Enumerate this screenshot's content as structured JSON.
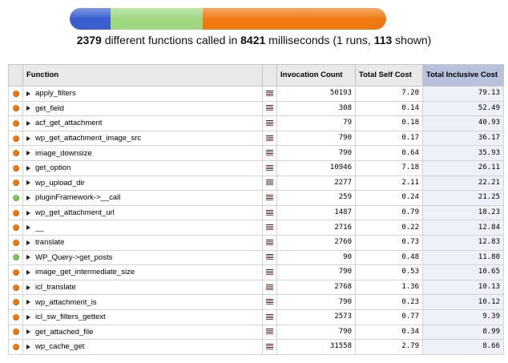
{
  "overview_bar": {
    "segments": [
      {
        "name": "blue",
        "share": 0.13,
        "color": "#3b5fd0"
      },
      {
        "name": "green",
        "share": 0.29,
        "color": "#9fd680"
      },
      {
        "name": "orange",
        "share": 0.58,
        "color": "#f07a12"
      }
    ]
  },
  "summary": {
    "function_count": "2379",
    "text1": " different functions called in ",
    "milliseconds": "8421",
    "text2": " milliseconds (1 runs, ",
    "shown": "113",
    "text3": " shown)"
  },
  "table": {
    "headers": {
      "function": "Function",
      "invocation_count": "Invocation Count",
      "total_self_cost": "Total Self Cost",
      "total_inclusive_cost": "Total Inclusive Cost"
    },
    "colors": {
      "orange": "#f07a12",
      "green": "#7ec956"
    },
    "rows": [
      {
        "name": "apply_filters",
        "dot": "orange",
        "count": "50193",
        "self": "7.20",
        "incl": "79.13"
      },
      {
        "name": "get_field",
        "dot": "orange",
        "count": "308",
        "self": "0.14",
        "incl": "52.49"
      },
      {
        "name": "acf_get_attachment",
        "dot": "orange",
        "count": "79",
        "self": "0.18",
        "incl": "40.93"
      },
      {
        "name": "wp_get_attachment_image_src",
        "dot": "orange",
        "count": "790",
        "self": "0.17",
        "incl": "36.17"
      },
      {
        "name": "image_downsize",
        "dot": "orange",
        "count": "790",
        "self": "0.64",
        "incl": "35.93"
      },
      {
        "name": "get_option",
        "dot": "orange",
        "count": "10946",
        "self": "7.18",
        "incl": "26.11"
      },
      {
        "name": "wp_upload_dir",
        "dot": "orange",
        "count": "2277",
        "self": "2.11",
        "incl": "22.21"
      },
      {
        "name": "pluginFramework->__call",
        "dot": "green",
        "count": "259",
        "self": "0.24",
        "incl": "21.25"
      },
      {
        "name": "wp_get_attachment_url",
        "dot": "orange",
        "count": "1487",
        "self": "0.79",
        "incl": "18.23"
      },
      {
        "name": "__",
        "dot": "orange",
        "count": "2716",
        "self": "0.22",
        "incl": "12.84"
      },
      {
        "name": "translate",
        "dot": "orange",
        "count": "2760",
        "self": "0.73",
        "incl": "12.83"
      },
      {
        "name": "WP_Query->get_posts",
        "dot": "green",
        "count": "90",
        "self": "0.48",
        "incl": "11.80"
      },
      {
        "name": "image_get_intermediate_size",
        "dot": "orange",
        "count": "790",
        "self": "0.53",
        "incl": "10.65"
      },
      {
        "name": "icl_translate",
        "dot": "orange",
        "count": "2768",
        "self": "1.36",
        "incl": "10.13"
      },
      {
        "name": "wp_attachment_is",
        "dot": "orange",
        "count": "790",
        "self": "0.23",
        "incl": "10.12"
      },
      {
        "name": "icl_sw_filters_gettext",
        "dot": "orange",
        "count": "2573",
        "self": "0.77",
        "incl": "9.39"
      },
      {
        "name": "get_attached_file",
        "dot": "orange",
        "count": "790",
        "self": "0.34",
        "incl": "8.99"
      },
      {
        "name": "wp_cache_get",
        "dot": "orange",
        "count": "31558",
        "self": "2.79",
        "incl": "8.66"
      }
    ]
  }
}
